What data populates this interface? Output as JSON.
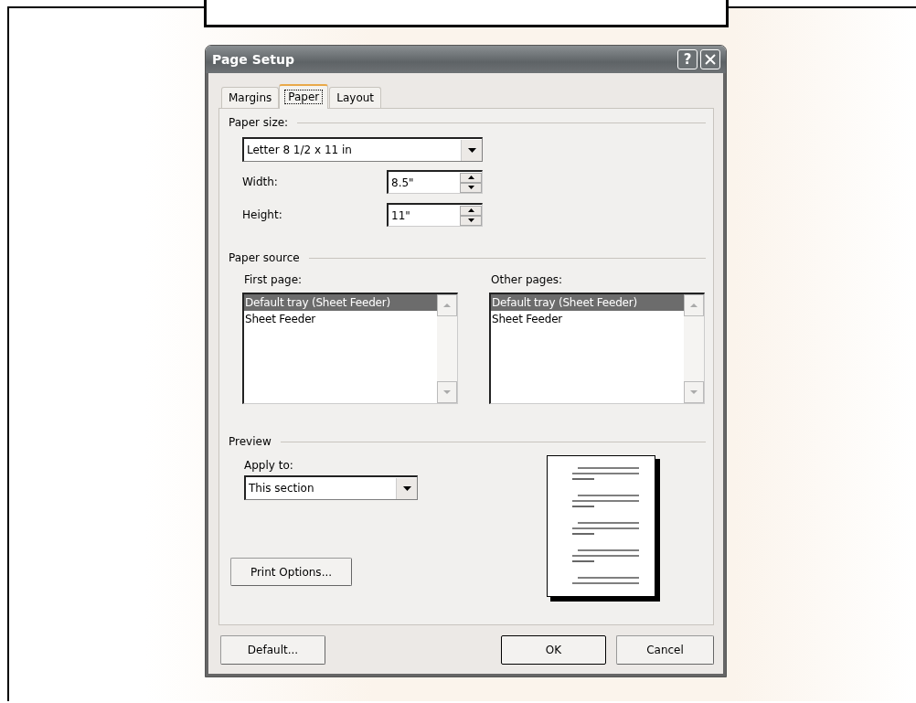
{
  "window": {
    "title": "Page Setup",
    "help_label": "?"
  },
  "tabs": [
    {
      "label": "Margins",
      "selected": false
    },
    {
      "label": "Paper",
      "selected": true
    },
    {
      "label": "Layout",
      "selected": false
    }
  ],
  "paper_size": {
    "label": "Paper size:",
    "select": {
      "value": "Letter 8 1/2 x 11 in"
    },
    "fields": [
      {
        "label": "Width:",
        "value": "8.5\""
      },
      {
        "label": "Height:",
        "value": "11\""
      }
    ]
  },
  "paper_source": {
    "label": "Paper source",
    "lists": [
      {
        "label": "First page:",
        "items": [
          {
            "text": "Default tray (Sheet Feeder)",
            "selected": true
          },
          {
            "text": "Sheet Feeder",
            "selected": false
          }
        ]
      },
      {
        "label": "Other pages:",
        "items": [
          {
            "text": "Default tray (Sheet Feeder)",
            "selected": true
          },
          {
            "text": "Sheet Feeder",
            "selected": false
          }
        ]
      }
    ]
  },
  "preview": {
    "label": "Preview",
    "apply_to": {
      "label": "Apply to:",
      "value": "This section"
    },
    "print_options_button": "Print Options..."
  },
  "buttons": [
    {
      "label": "Default...",
      "kind": "left"
    },
    {
      "label": "OK",
      "kind": "default"
    },
    {
      "label": "Cancel",
      "kind": "normal"
    }
  ]
}
